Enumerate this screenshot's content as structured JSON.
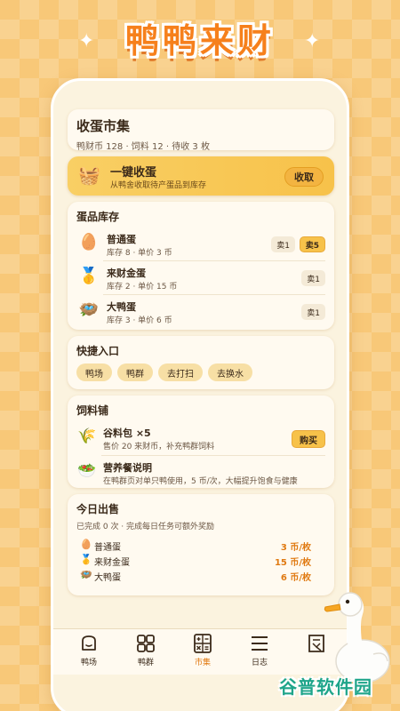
{
  "app_title": "鸭鸭来财",
  "market": {
    "title": "收蛋市集",
    "summary": "鸭财币 128 · 饲料 12 · 待收 3 枚"
  },
  "collect": {
    "title": "一键收蛋",
    "subtitle": "从鸭舍收取待产蛋品到库存",
    "button": "收取"
  },
  "inventory": {
    "title": "蛋品库存",
    "items": [
      {
        "name": "普通蛋",
        "meta": "库存 8 · 单价 3 币",
        "sell1": "卖1",
        "sell5": "卖5",
        "icon": "egg-icon"
      },
      {
        "name": "来财金蛋",
        "meta": "库存 2 · 单价 15 币",
        "sell1": "卖1",
        "icon": "gold-medal-icon"
      },
      {
        "name": "大鸭蛋",
        "meta": "库存 3 · 单价 6 币",
        "sell1": "卖1",
        "icon": "nest-icon"
      }
    ]
  },
  "shortcuts": {
    "title": "快捷入口",
    "chips": [
      "鸭场",
      "鸭群",
      "去打扫",
      "去换水"
    ]
  },
  "feed_shop": {
    "title": "饲料铺",
    "items": [
      {
        "name": "谷料包 ×5",
        "meta": "售价 20 来财币，补充鸭群饲料",
        "button": "购买",
        "icon": "grain-icon"
      },
      {
        "name": "营养餐说明",
        "meta": "在鸭群页对单只鸭使用，5 币/次，大幅提升饱食与健康",
        "icon": "salad-icon"
      }
    ]
  },
  "today_sales": {
    "title": "今日出售",
    "subtitle": "已完成 0 次 · 完成每日任务可额外奖励",
    "rows": [
      {
        "name": "普通蛋",
        "price": "3 币/枚",
        "icon": "egg-icon"
      },
      {
        "name": "来财金蛋",
        "price": "15 币/枚",
        "icon": "gold-medal-icon"
      },
      {
        "name": "大鸭蛋",
        "price": "6 币/枚",
        "icon": "nest-icon"
      }
    ]
  },
  "tabs": [
    {
      "label": "鸭场",
      "icon": "home-icon",
      "active": false
    },
    {
      "label": "鸭群",
      "icon": "grid-icon",
      "active": false
    },
    {
      "label": "市集",
      "icon": "calculator-icon",
      "active": true
    },
    {
      "label": "日志",
      "icon": "menu-icon",
      "active": false
    },
    {
      "label": "",
      "icon": "document-icon",
      "active": false
    }
  ],
  "watermark": "谷普软件园",
  "colors": {
    "accent": "#f6801c",
    "button": "#f7c24a",
    "price": "#e07a12",
    "background": "#f8c878"
  }
}
